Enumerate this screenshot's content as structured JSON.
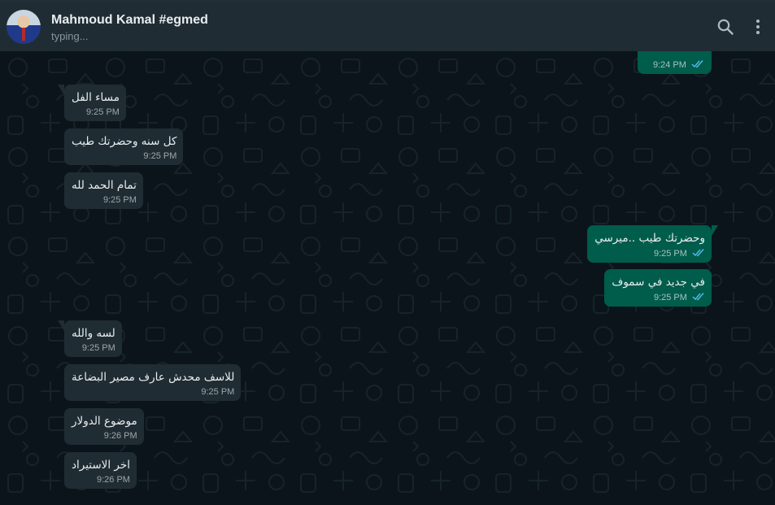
{
  "contact": {
    "name": "Mahmoud Kamal #egmed",
    "status": "typing..."
  },
  "icons": {
    "search": "search-icon",
    "menu": "more-vertical-icon",
    "read_receipt": "double-check-icon"
  },
  "colors": {
    "background": "#0b141a",
    "header": "#202c33",
    "incoming_bubble": "#202c33",
    "outgoing_bubble": "#005c4b",
    "read_tick": "#53bdeb"
  },
  "messages": [
    {
      "direction": "out",
      "text": "",
      "time": "9:24 PM",
      "read": true
    },
    {
      "direction": "in",
      "text": "مساء الفل",
      "time": "9:25 PM"
    },
    {
      "direction": "in",
      "text": "كل سنه وحضرتك طيب",
      "time": "9:25 PM"
    },
    {
      "direction": "in",
      "text": "تمام الحمد لله",
      "time": "9:25 PM"
    },
    {
      "direction": "out",
      "text": "وحضرتك طيب ..ميرسي",
      "time": "9:25 PM",
      "read": true
    },
    {
      "direction": "out",
      "text": "في جديد في سموف",
      "time": "9:25 PM",
      "read": true
    },
    {
      "direction": "in",
      "text": "لسه والله",
      "time": "9:25 PM"
    },
    {
      "direction": "in",
      "text": "للاسف محدش عارف مصير البضاعة",
      "time": "9:25 PM"
    },
    {
      "direction": "in",
      "text": "موضوع الدولار",
      "time": "9:26 PM"
    },
    {
      "direction": "in",
      "text": "اخر الاستيراد",
      "time": "9:26 PM"
    }
  ]
}
